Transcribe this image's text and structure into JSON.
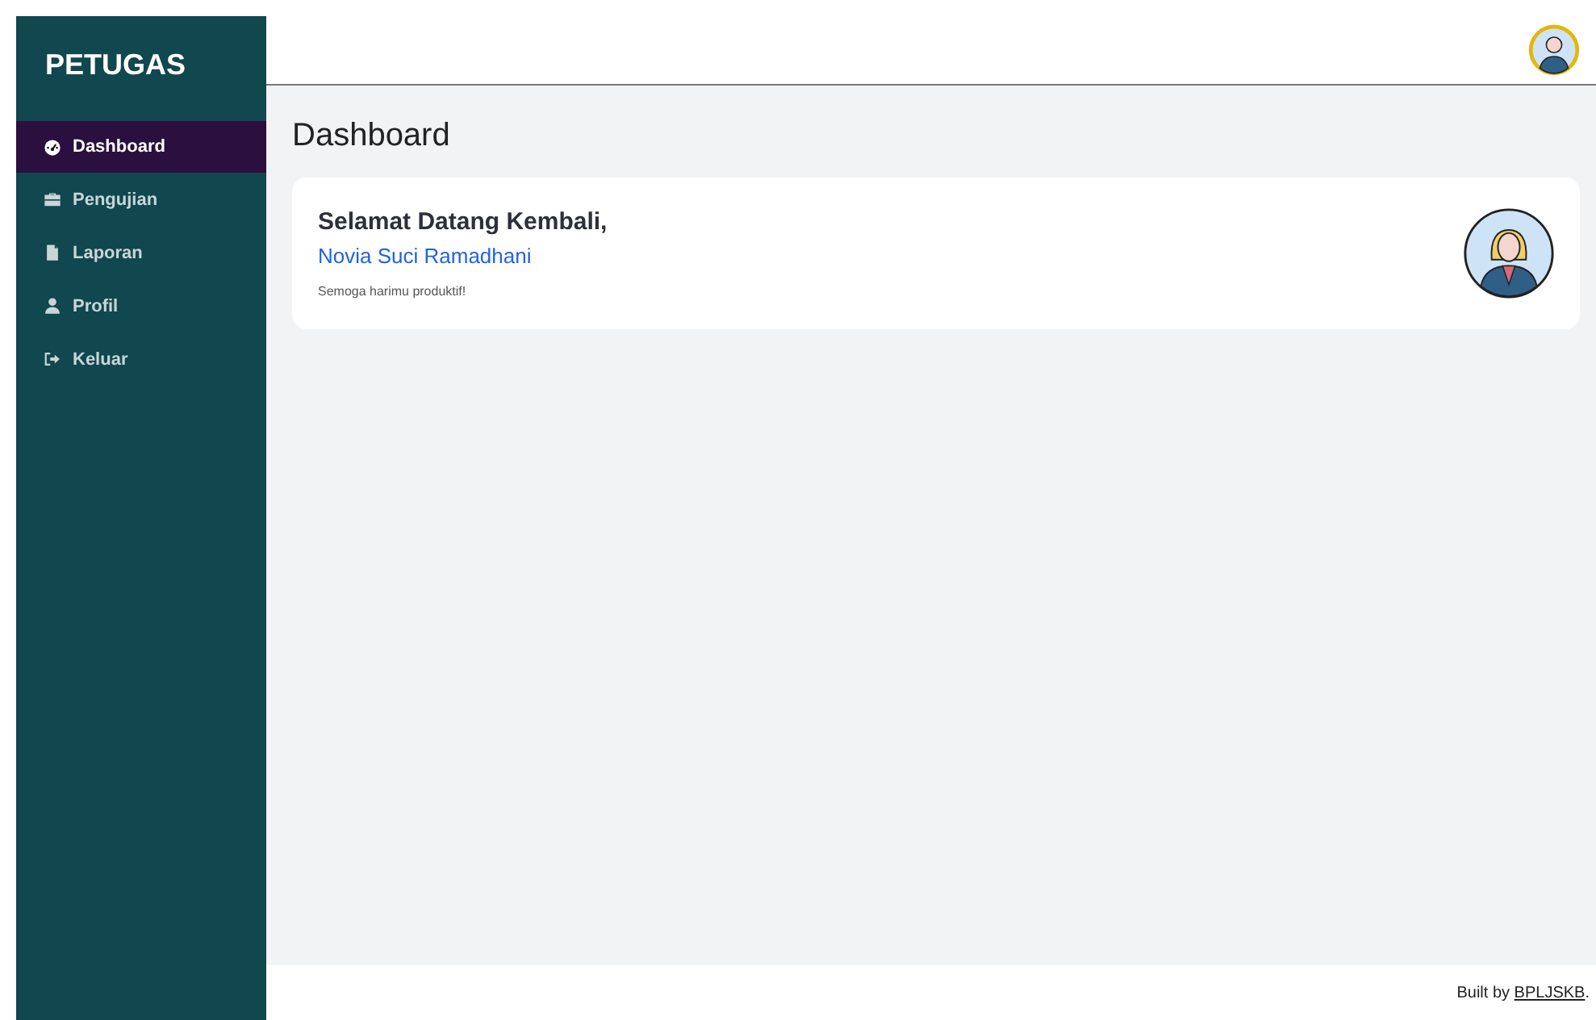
{
  "sidebar": {
    "brand": "PETUGAS",
    "items": [
      {
        "label": "Dashboard",
        "selected": true
      },
      {
        "label": "Pengujian",
        "selected": false
      },
      {
        "label": "Laporan",
        "selected": false
      },
      {
        "label": "Profil",
        "selected": false
      },
      {
        "label": "Keluar",
        "selected": false
      }
    ]
  },
  "page_title": "Dashboard",
  "welcome_card": {
    "greeting": "Selamat Datang Kembali,",
    "name": "Novia Suci Ramadhani",
    "message": "Semoga harimu produktif!"
  },
  "footer": {
    "prefix": "Built by",
    "link": "BPLJSKB",
    "suffix": "."
  }
}
